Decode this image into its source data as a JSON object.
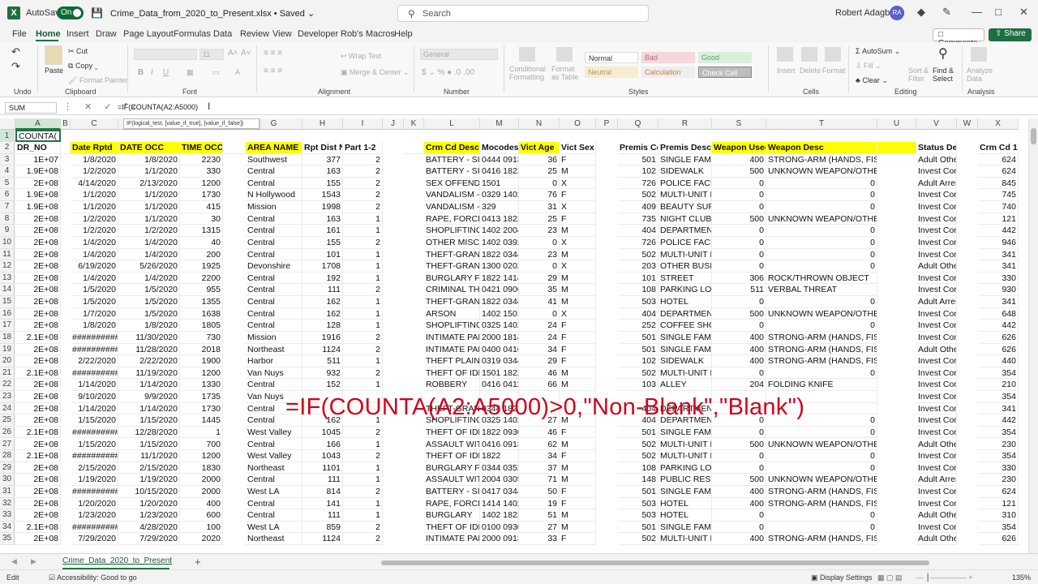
{
  "app": {
    "autosave_label": "AutoSave",
    "autosave_state": "On",
    "filename": "Crime_Data_from_2020_to_Present.xlsx",
    "save_status": "• Saved",
    "search_placeholder": "Search",
    "user_name": "Robert Adagbedu",
    "user_initials": "RA"
  },
  "menu": [
    "File",
    "Home",
    "Insert",
    "Draw",
    "Page Layout",
    "Formulas",
    "Data",
    "Review",
    "View",
    "Developer",
    "Rob's Macros",
    "Help"
  ],
  "buttons": {
    "comments": "Comments",
    "share": "Share"
  },
  "ribbon": {
    "groups": [
      "Undo",
      "Clipboard",
      "Font",
      "Alignment",
      "Number",
      "Styles",
      "Cells",
      "Editing",
      "Analysis"
    ],
    "paste": "Paste",
    "cut": "Cut",
    "copy": "Copy",
    "format_painter": "Format Painter",
    "font_size": "11",
    "wrap_text": "Wrap Text",
    "merge_center": "Merge & Center",
    "number_format": "General",
    "conditional_formatting": "Conditional Formatting",
    "format_as_table": "Format as Table",
    "style_normal": "Normal",
    "style_bad": "Bad",
    "style_good": "Good",
    "style_neutral": "Neutral",
    "style_calculation": "Calculation",
    "style_check": "Check Cell",
    "insert": "Insert",
    "delete": "Delete",
    "format": "Format",
    "autosum": "AutoSum",
    "fill": "Fill",
    "clear": "Clear",
    "sort_filter": "Sort & Filter",
    "find_select": "Find & Select",
    "analyze_data": "Analyze Data"
  },
  "formula_bar": {
    "name_box": "SUM",
    "formula": "=IF(COUNTA(A2:A5000)",
    "tooltip": "IF(logical_test, [value_if_true], [value_if_false])"
  },
  "overlay_formula": "=IF(COUNTA(A2:A5000)>0,\"Non-Blank\",\"Blank\")",
  "columns": [
    "A",
    "B",
    "C",
    "D",
    "E",
    "F",
    "G",
    "H",
    "I",
    "J",
    "K",
    "L",
    "M",
    "N",
    "O",
    "P",
    "Q",
    "R",
    "S",
    "T",
    "U",
    "V",
    "W",
    "X"
  ],
  "row_numbers": [
    "1",
    "2",
    "3",
    "4",
    "5",
    "6",
    "7",
    "8",
    "9",
    "10",
    "11",
    "12",
    "13",
    "14",
    "15",
    "16",
    "17",
    "18",
    "19",
    "20",
    "21",
    "22",
    "23",
    "24",
    "25",
    "26",
    "27",
    "28",
    "29",
    "30",
    "31",
    "32",
    "33",
    "34",
    "35"
  ],
  "active_cell_text": "COUNTA(",
  "headers": {
    "A": "DR_NO",
    "C": "Date Rptd",
    "D": "DATE OCC",
    "E": "TIME OCC",
    "G": "AREA NAME",
    "H": "Rpt Dist N",
    "I": "Part 1-2",
    "L": "Crm Cd Desc",
    "M": "Mocodes",
    "N": "Vict Age",
    "O": "Vict Sex",
    "Q": "Premis Cd",
    "R": "Premis Desc",
    "S": "Weapon Used",
    "T": "Weapon Desc",
    "V": "Status Desc",
    "X": "Crm Cd 1"
  },
  "rows": [
    [
      "1E+07",
      "1/8/2020",
      "1/8/2020",
      "2230",
      "Southwest",
      "377",
      "2",
      "BATTERY - SIM",
      "0444 0913",
      "36",
      "F",
      "501",
      "SINGLE FAMIL",
      "400",
      "STRONG-ARM (HANDS, FIST, FEET OR BO",
      "Adult Other",
      "624"
    ],
    [
      "1.9E+08",
      "1/2/2020",
      "1/1/2020",
      "330",
      "Central",
      "163",
      "2",
      "BATTERY - SIM",
      "0416 1822",
      "25",
      "M",
      "102",
      "SIDEWALK",
      "500",
      "UNKNOWN WEAPON/OTHER WEAPON",
      "Invest Cont",
      "624"
    ],
    [
      "2E+08",
      "4/14/2020",
      "2/13/2020",
      "1200",
      "Central",
      "155",
      "2",
      "SEX OFFENDER",
      "1501",
      "0",
      "X",
      "726",
      "POLICE FACILIT",
      "0",
      "0",
      "Adult Arrest",
      "845"
    ],
    [
      "1.9E+08",
      "1/1/2020",
      "1/1/2020",
      "1730",
      "N Hollywood",
      "1543",
      "2",
      "VANDALISM -",
      "0329 1402",
      "76",
      "F",
      "502",
      "MULTI-UNIT D",
      "0",
      "0",
      "Invest Cont",
      "745"
    ],
    [
      "1.9E+08",
      "1/1/2020",
      "1/1/2020",
      "415",
      "Mission",
      "1998",
      "2",
      "VANDALISM -",
      "329",
      "31",
      "X",
      "409",
      "BEAUTY SUPP",
      "0",
      "0",
      "Invest Cont",
      "740"
    ],
    [
      "2E+08",
      "1/2/2020",
      "1/1/2020",
      "30",
      "Central",
      "163",
      "1",
      "RAPE, FORCIBI",
      "0413 1822",
      "25",
      "F",
      "735",
      "NIGHT CLUB (C",
      "500",
      "UNKNOWN WEAPON/OTHER WEAPON",
      "Invest Cont",
      "121"
    ],
    [
      "2E+08",
      "1/2/2020",
      "1/2/2020",
      "1315",
      "Central",
      "161",
      "1",
      "SHOPLIFTING -",
      "1402 2004",
      "23",
      "M",
      "404",
      "DEPARTMENT",
      "0",
      "0",
      "Invest Cont",
      "442"
    ],
    [
      "2E+08",
      "1/4/2020",
      "1/4/2020",
      "40",
      "Central",
      "155",
      "2",
      "OTHER MISCEL",
      "1402 0392",
      "0",
      "X",
      "726",
      "POLICE FACILIT",
      "0",
      "0",
      "Invest Cont",
      "946"
    ],
    [
      "2E+08",
      "1/4/2020",
      "1/4/2020",
      "200",
      "Central",
      "101",
      "1",
      "THEFT-GRAND",
      "1822 0344",
      "23",
      "M",
      "502",
      "MULTI-UNIT D",
      "0",
      "0",
      "Invest Cont",
      "341"
    ],
    [
      "2E+08",
      "6/19/2020",
      "5/26/2020",
      "1925",
      "Devonshire",
      "1708",
      "1",
      "THEFT-GRAND",
      "1300 0202",
      "0",
      "X",
      "203",
      "OTHER BUSINE",
      "0",
      "0",
      "Adult Other",
      "341"
    ],
    [
      "2E+08",
      "1/4/2020",
      "1/4/2020",
      "2200",
      "Central",
      "192",
      "1",
      "BURGLARY FR",
      "1822 1414",
      "29",
      "M",
      "101",
      "STREET",
      "306",
      "ROCK/THROWN OBJECT",
      "Invest Cont",
      "330"
    ],
    [
      "2E+08",
      "1/5/2020",
      "1/5/2020",
      "955",
      "Central",
      "111",
      "2",
      "CRIMINAL TH",
      "0421 0906",
      "35",
      "M",
      "108",
      "PARKING LOT",
      "511",
      "VERBAL THREAT",
      "Invest Cont",
      "930"
    ],
    [
      "2E+08",
      "1/5/2020",
      "1/5/2020",
      "1355",
      "Central",
      "162",
      "1",
      "THEFT-GRAND",
      "1822 0344",
      "41",
      "M",
      "503",
      "HOTEL",
      "0",
      "0",
      "Adult Arrest",
      "341"
    ],
    [
      "2E+08",
      "1/7/2020",
      "1/5/2020",
      "1638",
      "Central",
      "162",
      "1",
      "ARSON",
      "1402 1501",
      "0",
      "X",
      "404",
      "DEPARTMENT",
      "500",
      "UNKNOWN WEAPON/OTHER WEAPON",
      "Invest Cont",
      "648"
    ],
    [
      "2E+08",
      "1/8/2020",
      "1/8/2020",
      "1805",
      "Central",
      "128",
      "1",
      "SHOPLIFTING -",
      "0325 1402",
      "24",
      "F",
      "252",
      "COFFEE SHOP",
      "0",
      "0",
      "Invest Cont",
      "442"
    ],
    [
      "2.1E+08",
      "##########",
      "11/30/2020",
      "730",
      "Mission",
      "1916",
      "2",
      "INTIMATE PAR",
      "2000 1814",
      "24",
      "F",
      "501",
      "SINGLE FAMIL",
      "400",
      "STRONG-ARM (HANDS, FIST, FEET OR BO",
      "Invest Cont",
      "626"
    ],
    [
      "2E+08",
      "##########",
      "11/28/2020",
      "2018",
      "Northeast",
      "1124",
      "2",
      "INTIMATE PAR",
      "0400 0416",
      "34",
      "F",
      "501",
      "SINGLE FAMIL",
      "400",
      "STRONG-ARM (HANDS, FIST, FEET OR BO",
      "Adult Other",
      "626"
    ],
    [
      "2E+08",
      "2/22/2020",
      "2/22/2020",
      "1900",
      "Harbor",
      "511",
      "1",
      "THEFT PLAIN -",
      "0319 0344",
      "29",
      "F",
      "102",
      "SIDEWALK",
      "400",
      "STRONG-ARM (HANDS, FIST, FEET OR BO",
      "Invest Cont",
      "440"
    ],
    [
      "2.1E+08",
      "##########",
      "11/19/2020",
      "1200",
      "Van Nuys",
      "932",
      "2",
      "THEFT OF IDEI",
      "1501 1822",
      "46",
      "M",
      "502",
      "MULTI-UNIT D",
      "0",
      "0",
      "Invest Cont",
      "354"
    ],
    [
      "2E+08",
      "1/14/2020",
      "1/14/2020",
      "1330",
      "Central",
      "152",
      "1",
      "ROBBERY",
      "0416 0411",
      "66",
      "M",
      "103",
      "ALLEY",
      "204",
      "FOLDING KNIFE",
      "Invest Cont",
      "210"
    ],
    [
      "2E+08",
      "9/10/2020",
      "9/9/2020",
      "1735",
      "Van Nuys",
      "",
      "",
      "",
      "",
      "",
      "",
      "",
      "",
      "",
      "",
      "Invest Cont",
      "354"
    ],
    [
      "2E+08",
      "1/14/2020",
      "1/14/2020",
      "1730",
      "Central",
      "",
      "",
      "THEFT-GRAND",
      "0344 1822",
      "",
      "",
      "404",
      "DEPARTMENT",
      "",
      "",
      "Invest Cont",
      "341"
    ],
    [
      "2E+08",
      "1/15/2020",
      "1/15/2020",
      "1445",
      "Central",
      "162",
      "1",
      "SHOPLIFTING -",
      "0325 1402",
      "27",
      "M",
      "404",
      "DEPARTMENT",
      "0",
      "0",
      "Invest Cont",
      "442"
    ],
    [
      "2.1E+08",
      "##########",
      "12/28/2020",
      "1",
      "West Valley",
      "1045",
      "2",
      "THEFT OF IDEI",
      "1822 0930",
      "46",
      "F",
      "501",
      "SINGLE FAMIL",
      "0",
      "0",
      "Invest Cont",
      "354"
    ],
    [
      "2E+08",
      "1/15/2020",
      "1/15/2020",
      "700",
      "Central",
      "166",
      "1",
      "ASSAULT WITH",
      "0416 0913",
      "62",
      "M",
      "502",
      "MULTI-UNIT D",
      "500",
      "UNKNOWN WEAPON/OTHER WEAPON",
      "Adult Other",
      "230"
    ],
    [
      "2.1E+08",
      "##########",
      "11/1/2020",
      "1200",
      "West Valley",
      "1043",
      "2",
      "THEFT OF IDEI",
      "1822",
      "34",
      "F",
      "502",
      "MULTI-UNIT D",
      "0",
      "0",
      "Invest Cont",
      "354"
    ],
    [
      "2E+08",
      "2/15/2020",
      "2/15/2020",
      "1830",
      "Northeast",
      "1101",
      "1",
      "BURGLARY FR",
      "0344 0352",
      "37",
      "M",
      "108",
      "PARKING LOT",
      "0",
      "0",
      "Invest Cont",
      "330"
    ],
    [
      "2E+08",
      "1/19/2020",
      "1/19/2020",
      "2000",
      "Central",
      "111",
      "1",
      "ASSAULT WITH",
      "2004 0305",
      "71",
      "M",
      "148",
      "PUBLIC RESTRO",
      "500",
      "UNKNOWN WEAPON/OTHER WEAPON",
      "Adult Arrest",
      "230"
    ],
    [
      "2E+08",
      "##########",
      "10/15/2020",
      "2000",
      "West LA",
      "814",
      "2",
      "BATTERY - SIM",
      "0417 0344",
      "50",
      "F",
      "501",
      "SINGLE FAMIL",
      "400",
      "STRONG-ARM (HANDS, FIST, FEET OR BO",
      "Invest Cont",
      "624"
    ],
    [
      "2E+08",
      "1/20/2020",
      "1/20/2020",
      "400",
      "Central",
      "141",
      "1",
      "RAPE, FORCIBI",
      "1414 1402",
      "19",
      "F",
      "503",
      "HOTEL",
      "400",
      "STRONG-ARM (HANDS, FIST, FEET OR BO",
      "Invest Cont",
      "121"
    ],
    [
      "2E+08",
      "1/23/2020",
      "1/23/2020",
      "600",
      "Central",
      "111",
      "1",
      "BURGLARY",
      "1402 1822",
      "51",
      "M",
      "503",
      "HOTEL",
      "0",
      "0",
      "Adult Other",
      "310"
    ],
    [
      "2.1E+08",
      "##########",
      "4/28/2020",
      "100",
      "West LA",
      "859",
      "2",
      "THEFT OF IDEI",
      "0100 0930",
      "27",
      "M",
      "501",
      "SINGLE FAMIL",
      "0",
      "0",
      "Invest Cont",
      "354"
    ],
    [
      "2E+08",
      "7/29/2020",
      "7/29/2020",
      "2020",
      "Northeast",
      "1124",
      "2",
      "INTIMATE PAR",
      "2000 0913",
      "33",
      "F",
      "502",
      "MULTI-UNIT D",
      "400",
      "STRONG-ARM (HANDS, FIST, FEET OR BO",
      "Adult Other",
      "626"
    ]
  ],
  "sheet_tab": "Crime_Data_2020_to_Present",
  "status": {
    "mode": "Edit",
    "accessibility": "Accessibility: Good to go",
    "display": "Display Settings",
    "zoom": "135%"
  }
}
